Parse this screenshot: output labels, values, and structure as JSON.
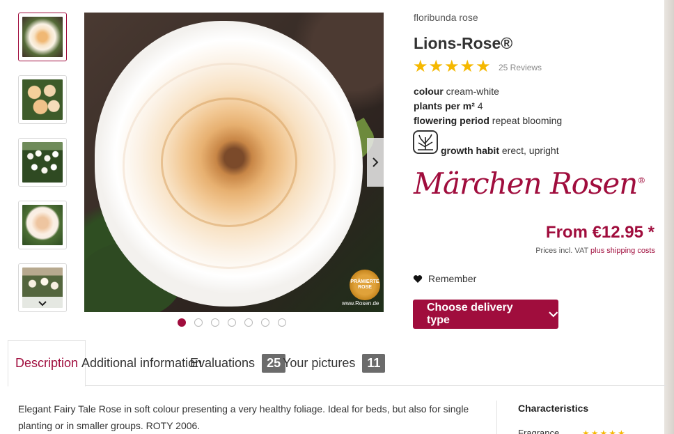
{
  "gallery": {
    "thumbnails": [
      {
        "name": "thumbnail-1"
      },
      {
        "name": "thumbnail-2"
      },
      {
        "name": "thumbnail-3"
      },
      {
        "name": "thumbnail-4"
      },
      {
        "name": "thumbnail-5"
      }
    ],
    "watermark": "www.Rosen.de",
    "badge_text": "PRÄMIERTE ROSE",
    "slide_count": 7,
    "active_slide": 1
  },
  "product": {
    "category": "floribunda rose",
    "title": "Lions-Rose®",
    "rating": 5,
    "reviews_label": "25 Reviews",
    "properties": [
      {
        "label": "colour",
        "value": "cream-white"
      },
      {
        "label": "plants per m²",
        "value": "4"
      },
      {
        "label": "flowering period",
        "value": "repeat blooming"
      },
      {
        "label": "growth habit",
        "value": "erect, upright"
      }
    ],
    "brand": "Märchen Rosen",
    "brand_mark": "®",
    "price": "From €12.95 *",
    "vat_text": "Prices incl. VAT",
    "shipping_link": "plus shipping costs",
    "remember_label": "Remember",
    "delivery_button": "Choose delivery type"
  },
  "tabs": [
    {
      "label": "Description",
      "badge": ""
    },
    {
      "label": "Additional information",
      "badge": ""
    },
    {
      "label": "Evaluations",
      "badge": "25"
    },
    {
      "label": "Your pictures",
      "badge": "11"
    }
  ],
  "description": "Elegant Fairy Tale Rose in soft colour presenting a very healthy foliage. Ideal for beds, but also for single planting or in smaller groups. ROTY 2006.",
  "characteristics": {
    "title": "Characteristics",
    "first_row_label": "Fragrance"
  },
  "colors": {
    "accent": "#a00d3d",
    "star": "#f5b800",
    "badge": "#6b6b6b"
  }
}
